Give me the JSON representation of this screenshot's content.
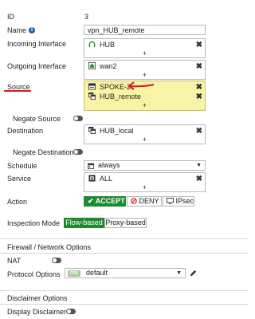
{
  "fields": {
    "id": {
      "label": "ID",
      "value": "3"
    },
    "name": {
      "label": "Name",
      "value": "vpn_HUB_remote"
    },
    "incoming": {
      "label": "Incoming Interface",
      "items": [
        "HUB"
      ]
    },
    "outgoing": {
      "label": "Outgoing Interface",
      "items": [
        "wan2"
      ]
    },
    "source": {
      "label": "Source",
      "items": [
        "SPOKE-2",
        "HUB_remote"
      ]
    },
    "negate_source": {
      "label": "Negate Source"
    },
    "destination": {
      "label": "Destination",
      "items": [
        "HUB_local"
      ]
    },
    "negate_destination": {
      "label": "Negate Destination"
    },
    "schedule": {
      "label": "Schedule",
      "value": "always"
    },
    "service": {
      "label": "Service",
      "items": [
        "ALL"
      ]
    },
    "action": {
      "label": "Action",
      "options": [
        "ACCEPT",
        "DENY",
        "IPsec"
      ],
      "selected": "ACCEPT"
    },
    "inspection_mode": {
      "label": "Inspection Mode",
      "options": [
        "Flow-based",
        "Proxy-based"
      ],
      "selected": "Flow-based"
    }
  },
  "firewall_section": {
    "title": "Firewall / Network Options",
    "nat": {
      "label": "NAT"
    },
    "protocol_options": {
      "label": "Protocol Options",
      "badge": "PRX",
      "value": "default"
    }
  },
  "disclaimer_section": {
    "title": "Disclaimer Options",
    "display_disclaimer": {
      "label": "Display Disclaimer"
    }
  },
  "common": {
    "add_symbol": "+",
    "remove_symbol": "✖"
  },
  "colors": {
    "accent_green": "#1f8a2f",
    "highlight_yellow": "#f8f4a5",
    "annotation_red": "#e0141e"
  }
}
